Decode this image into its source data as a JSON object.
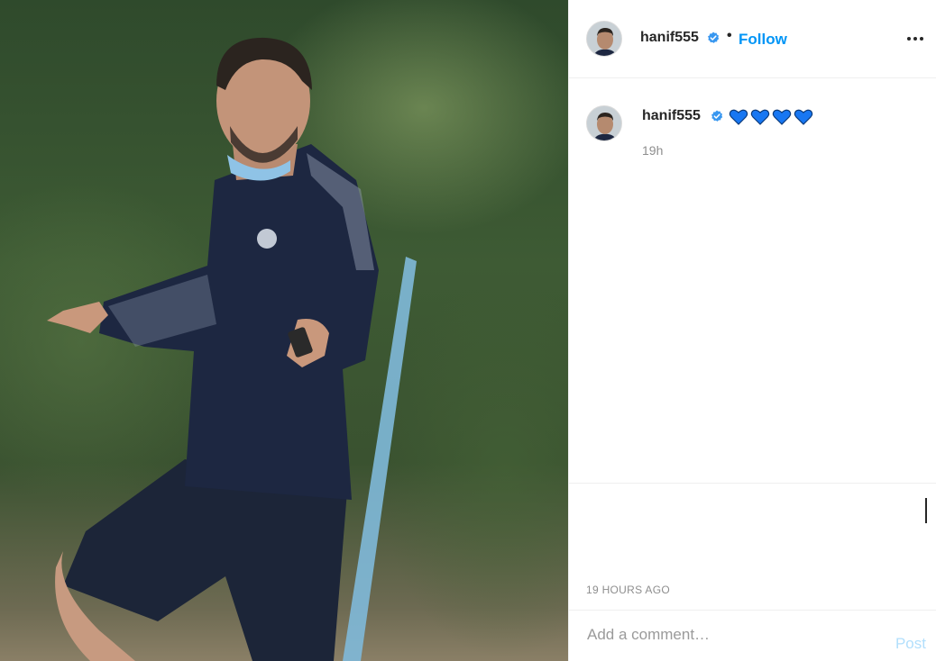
{
  "post": {
    "username": "hanif555",
    "follow_label": "Follow",
    "separator": "•",
    "verified_icon": "verified-badge-icon",
    "more_icon": "more-options-icon"
  },
  "caption": {
    "username": "hanif555",
    "emoji": [
      "blue-heart",
      "blue-heart",
      "blue-heart",
      "blue-heart"
    ],
    "time": "19h"
  },
  "meta": {
    "timestamp": "19 HOURS AGO"
  },
  "comment": {
    "placeholder": "Add a comment…",
    "post_label": "Post"
  },
  "colors": {
    "link": "#0095f6",
    "post_disabled": "#b2dffc",
    "verified": "#3897f0",
    "heart": "#1877f2"
  }
}
